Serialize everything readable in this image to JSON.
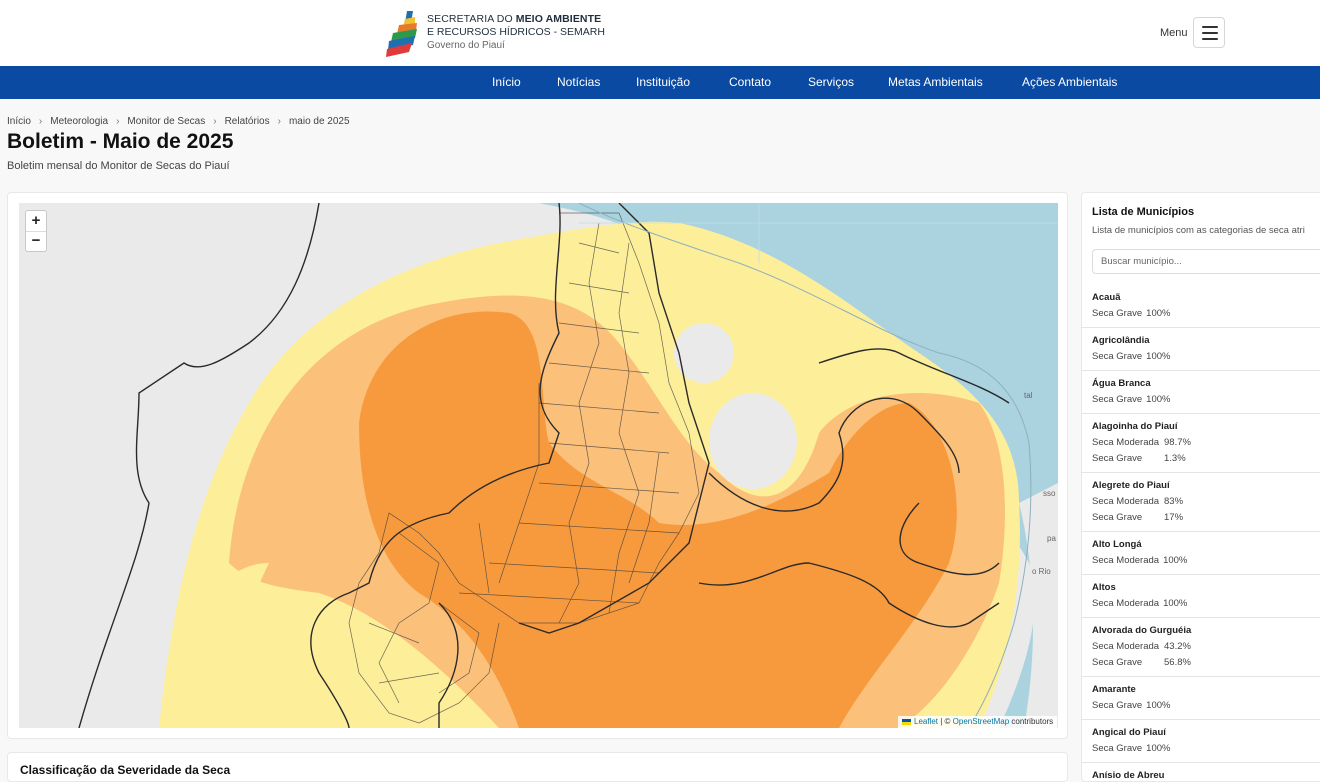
{
  "header": {
    "logo_line1_normal": "SECRETARIA DO ",
    "logo_line1_bold": "MEIO AMBIENTE",
    "logo_line2": "E RECURSOS HÍDRICOS - SEMARH",
    "logo_line3": "Governo do Piauí",
    "menu_label": "Menu"
  },
  "nav": [
    "Início",
    "Notícias",
    "Instituição",
    "Contato",
    "Serviços",
    "Metas Ambientais",
    "Ações Ambientais"
  ],
  "breadcrumb": [
    "Início",
    "Meteorologia",
    "Monitor de Secas",
    "Relatórios",
    "maio de 2025"
  ],
  "page": {
    "title": "Boletim - Maio de 2025",
    "subtitle": "Boletim mensal do Monitor de Secas do Piauí"
  },
  "map": {
    "zoom_in": "+",
    "zoom_out": "−",
    "attribution_leaflet": "Leaflet",
    "attribution_sep": " | © ",
    "attribution_osm": "OpenStreetMap",
    "attribution_suffix": " contributors",
    "side_labels": [
      "tal",
      "sso",
      "pa",
      "o Rio"
    ],
    "colors": {
      "sea": "#aad3df",
      "land": "#eaeaea",
      "light": "#fdee9a",
      "moderate": "#fbc07a",
      "severe": "#f79a3e",
      "border": "#2a2a2a"
    }
  },
  "classification_card": {
    "title": "Classificação da Severidade da Seca"
  },
  "panel": {
    "title": "Lista de Municípios",
    "description": "Lista de municípios com as categorias de seca atri",
    "search_placeholder": "Buscar município...",
    "municipios": [
      {
        "name": "Acauã",
        "rows": [
          {
            "cat": "Seca Grave",
            "pct": "100%"
          }
        ]
      },
      {
        "name": "Agricolândia",
        "rows": [
          {
            "cat": "Seca Grave",
            "pct": "100%"
          }
        ]
      },
      {
        "name": "Água Branca",
        "rows": [
          {
            "cat": "Seca Grave",
            "pct": "100%"
          }
        ]
      },
      {
        "name": "Alagoinha do Piauí",
        "rows": [
          {
            "cat": "Seca Moderada",
            "pct": "98.7%"
          },
          {
            "cat": "Seca Grave",
            "pct": "1.3%"
          }
        ]
      },
      {
        "name": "Alegrete do Piauí",
        "rows": [
          {
            "cat": "Seca Moderada",
            "pct": "83%"
          },
          {
            "cat": "Seca Grave",
            "pct": "17%"
          }
        ]
      },
      {
        "name": "Alto Longá",
        "rows": [
          {
            "cat": "Seca Moderada",
            "pct": "100%"
          }
        ]
      },
      {
        "name": "Altos",
        "rows": [
          {
            "cat": "Seca Moderada",
            "pct": "100%"
          }
        ]
      },
      {
        "name": "Alvorada do Gurguéia",
        "rows": [
          {
            "cat": "Seca Moderada",
            "pct": "43.2%"
          },
          {
            "cat": "Seca Grave",
            "pct": "56.8%"
          }
        ]
      },
      {
        "name": "Amarante",
        "rows": [
          {
            "cat": "Seca Grave",
            "pct": "100%"
          }
        ]
      },
      {
        "name": "Angical do Piauí",
        "rows": [
          {
            "cat": "Seca Grave",
            "pct": "100%"
          }
        ]
      },
      {
        "name": "Anísio de Abreu",
        "rows": [
          {
            "cat": "Seca Grave",
            "pct": "100%"
          }
        ]
      }
    ]
  }
}
